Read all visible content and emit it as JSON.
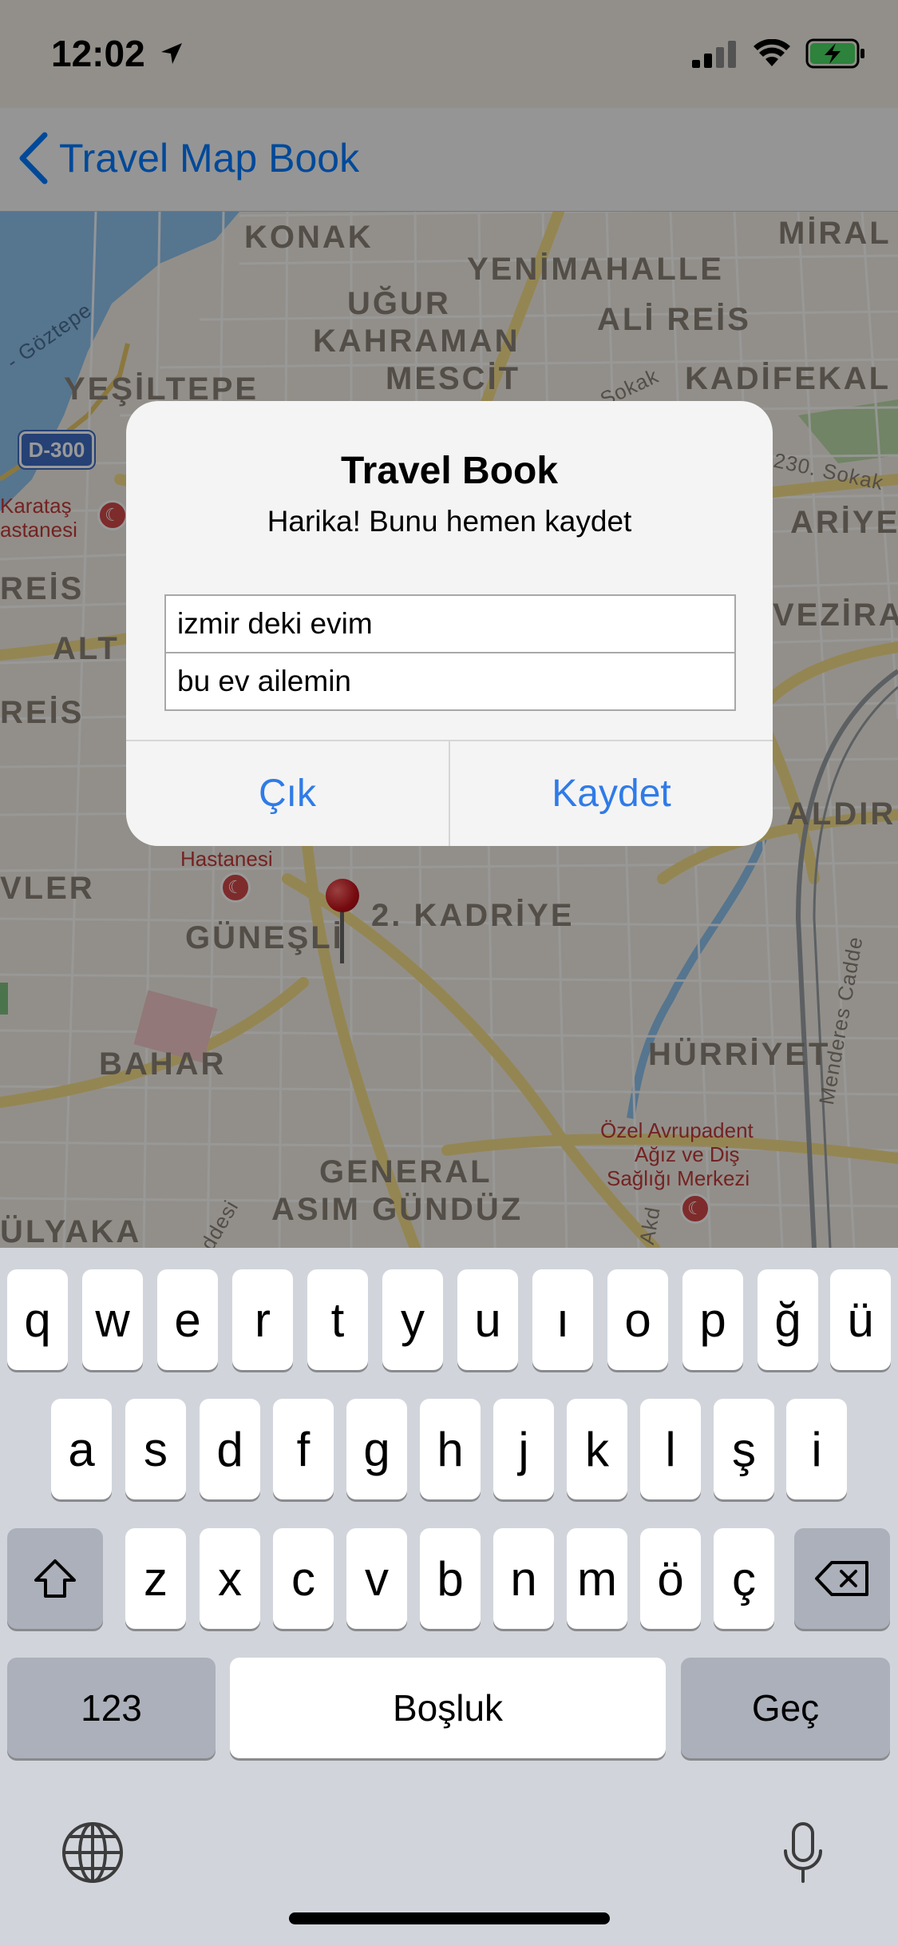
{
  "status_bar": {
    "time": "12:02"
  },
  "nav": {
    "back_label": "Travel Map Book"
  },
  "map": {
    "labels": {
      "konak": "KONAK",
      "miral": "MİRAL",
      "yenimahalle": "YENİMAHALLE",
      "ugur": "UĞUR",
      "ali_reis": "ALİ REİS",
      "kahraman": "KAHRAMAN",
      "mescit": "MESCİT",
      "kadifekale": "KADİFEKAL",
      "yesiltepe": "YEŞİLTEPE",
      "goztepe": "- Göztepe",
      "sokak": "Sokak",
      "sokak_230": "230. Sokak",
      "karatas": "Karataş",
      "hastanesi_top": "astanesi",
      "ariye": "ARİYE",
      "reis_left": "REİS",
      "alt": "ALT",
      "vezira": "VEZİRA",
      "reis_left2": "REİS",
      "caldir": "ALDIR",
      "hastanesi": "Hastanesi",
      "vler": "VLER",
      "guneşli": "GÜNEŞLİ",
      "kadriye": "2. KADRİYE",
      "bahar": "BAHAR",
      "hurriyet": "HÜRRİYET",
      "ozel": "Özel Avrupadent",
      "agiz": "Ağız ve Diş",
      "sagligi": "Sağlığı Merkezi",
      "menderes": "Menderes Cadde",
      "general": "GENERAL",
      "asim": "ASIM GÜNDÜZ",
      "ulyaka": "ÜLYAKA",
      "akd": "Akd",
      "ddesi": "ddesi",
      "highway": "D-300"
    }
  },
  "alert": {
    "title": "Travel Book",
    "message": "Harika! Bunu hemen kaydet",
    "field1_value": "izmir deki evim",
    "field2_value": "bu ev ailemin",
    "cancel_label": "Çık",
    "save_label": "Kaydet"
  },
  "keyboard": {
    "row1": [
      "q",
      "w",
      "e",
      "r",
      "t",
      "y",
      "u",
      "ı",
      "o",
      "p",
      "ğ",
      "ü"
    ],
    "row2": [
      "a",
      "s",
      "d",
      "f",
      "g",
      "h",
      "j",
      "k",
      "l",
      "ş",
      "i"
    ],
    "row3": [
      "z",
      "x",
      "c",
      "v",
      "b",
      "n",
      "m",
      "ö",
      "ç"
    ],
    "numbers_label": "123",
    "space_label": "Boşluk",
    "return_label": "Geç"
  },
  "colors": {
    "accent": "#2f7be8",
    "nav_blue": "#007aff",
    "key_func": "#abb0ba"
  }
}
